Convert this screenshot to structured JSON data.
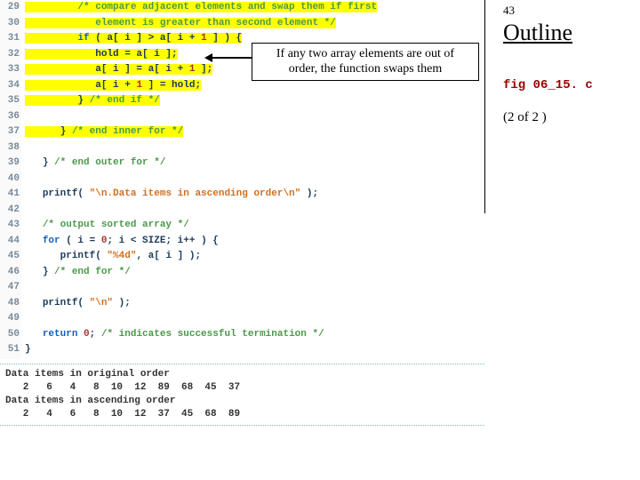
{
  "sidebar": {
    "page_number": "43",
    "title": "Outline",
    "fig_name": "fig 06_15. c",
    "pager": "(2 of 2 )"
  },
  "annotation": {
    "line1": "If any two array elements are out of",
    "line2": "order, the function swaps them"
  },
  "code_lines": [
    {
      "n": "29",
      "hl": true,
      "tokens": [
        {
          "c": "cmt",
          "t": "/* compare adjacent elements and swap them if first"
        }
      ],
      "indent": 9
    },
    {
      "n": "30",
      "hl": true,
      "tokens": [
        {
          "c": "cmt",
          "t": "   element is greater than second element */"
        }
      ],
      "indent": 9
    },
    {
      "n": "31",
      "hl": true,
      "tokens": [
        {
          "c": "kw",
          "t": "if"
        },
        {
          "c": "txt",
          "t": " ( a[ i ] > a[ i + "
        },
        {
          "c": "num",
          "t": "1"
        },
        {
          "c": "txt",
          "t": " ] ) {"
        }
      ],
      "indent": 9
    },
    {
      "n": "32",
      "hl": true,
      "tokens": [
        {
          "c": "txt",
          "t": "hold = a[ i ];"
        }
      ],
      "indent": 12
    },
    {
      "n": "33",
      "hl": true,
      "tokens": [
        {
          "c": "txt",
          "t": "a[ i ] = a[ i + "
        },
        {
          "c": "num",
          "t": "1"
        },
        {
          "c": "txt",
          "t": " ];"
        }
      ],
      "indent": 12
    },
    {
      "n": "34",
      "hl": true,
      "tokens": [
        {
          "c": "txt",
          "t": "a[ i + "
        },
        {
          "c": "num",
          "t": "1"
        },
        {
          "c": "txt",
          "t": " ] = hold;"
        }
      ],
      "indent": 12
    },
    {
      "n": "35",
      "hl": true,
      "tokens": [
        {
          "c": "txt",
          "t": "} "
        },
        {
          "c": "cmt",
          "t": "/* end if */"
        }
      ],
      "indent": 9
    },
    {
      "n": "36",
      "hl": false,
      "tokens": [],
      "indent": 0
    },
    {
      "n": "37",
      "hl": true,
      "tokens": [
        {
          "c": "txt",
          "t": "} "
        },
        {
          "c": "cmt",
          "t": "/* end inner for */"
        }
      ],
      "indent": 6
    },
    {
      "n": "38",
      "hl": false,
      "tokens": [],
      "indent": 0
    },
    {
      "n": "39",
      "hl": false,
      "tokens": [
        {
          "c": "txt",
          "t": "} "
        },
        {
          "c": "cmt",
          "t": "/* end outer for */"
        }
      ],
      "indent": 3
    },
    {
      "n": "40",
      "hl": false,
      "tokens": [],
      "indent": 0
    },
    {
      "n": "41",
      "hl": false,
      "tokens": [
        {
          "c": "txt",
          "t": "printf( "
        },
        {
          "c": "str",
          "t": "\"\\n.Data items in ascending order\\n\""
        },
        {
          "c": "txt",
          "t": " );"
        }
      ],
      "indent": 3
    },
    {
      "n": "42",
      "hl": false,
      "tokens": [],
      "indent": 0
    },
    {
      "n": "43",
      "hl": false,
      "tokens": [
        {
          "c": "cmt",
          "t": "/* output sorted array */"
        }
      ],
      "indent": 3
    },
    {
      "n": "44",
      "hl": false,
      "tokens": [
        {
          "c": "kw",
          "t": "for"
        },
        {
          "c": "txt",
          "t": " ( i = "
        },
        {
          "c": "num",
          "t": "0"
        },
        {
          "c": "txt",
          "t": "; i < SIZE; i++ ) {"
        }
      ],
      "indent": 3
    },
    {
      "n": "45",
      "hl": false,
      "tokens": [
        {
          "c": "txt",
          "t": "printf( "
        },
        {
          "c": "str",
          "t": "\"%4d\""
        },
        {
          "c": "txt",
          "t": ", a[ i ] );"
        }
      ],
      "indent": 6
    },
    {
      "n": "46",
      "hl": false,
      "tokens": [
        {
          "c": "txt",
          "t": "} "
        },
        {
          "c": "cmt",
          "t": "/* end for */"
        }
      ],
      "indent": 3
    },
    {
      "n": "47",
      "hl": false,
      "tokens": [],
      "indent": 0
    },
    {
      "n": "48",
      "hl": false,
      "tokens": [
        {
          "c": "txt",
          "t": "printf( "
        },
        {
          "c": "str",
          "t": "\"\\n\""
        },
        {
          "c": "txt",
          "t": " );"
        }
      ],
      "indent": 3
    },
    {
      "n": "49",
      "hl": false,
      "tokens": [],
      "indent": 0
    },
    {
      "n": "50",
      "hl": false,
      "tokens": [
        {
          "c": "kw",
          "t": "return"
        },
        {
          "c": "txt",
          "t": " "
        },
        {
          "c": "num",
          "t": "0"
        },
        {
          "c": "txt",
          "t": "; "
        },
        {
          "c": "cmt",
          "t": "/* indicates successful termination */"
        }
      ],
      "indent": 3
    },
    {
      "n": "51",
      "hl": false,
      "tokens": [
        {
          "c": "txt",
          "t": "}"
        }
      ],
      "indent": 0
    }
  ],
  "output": "Data items in original order\n   2   6   4   8  10  12  89  68  45  37\nData items in ascending order\n   2   4   6   8  10  12  37  45  68  89"
}
